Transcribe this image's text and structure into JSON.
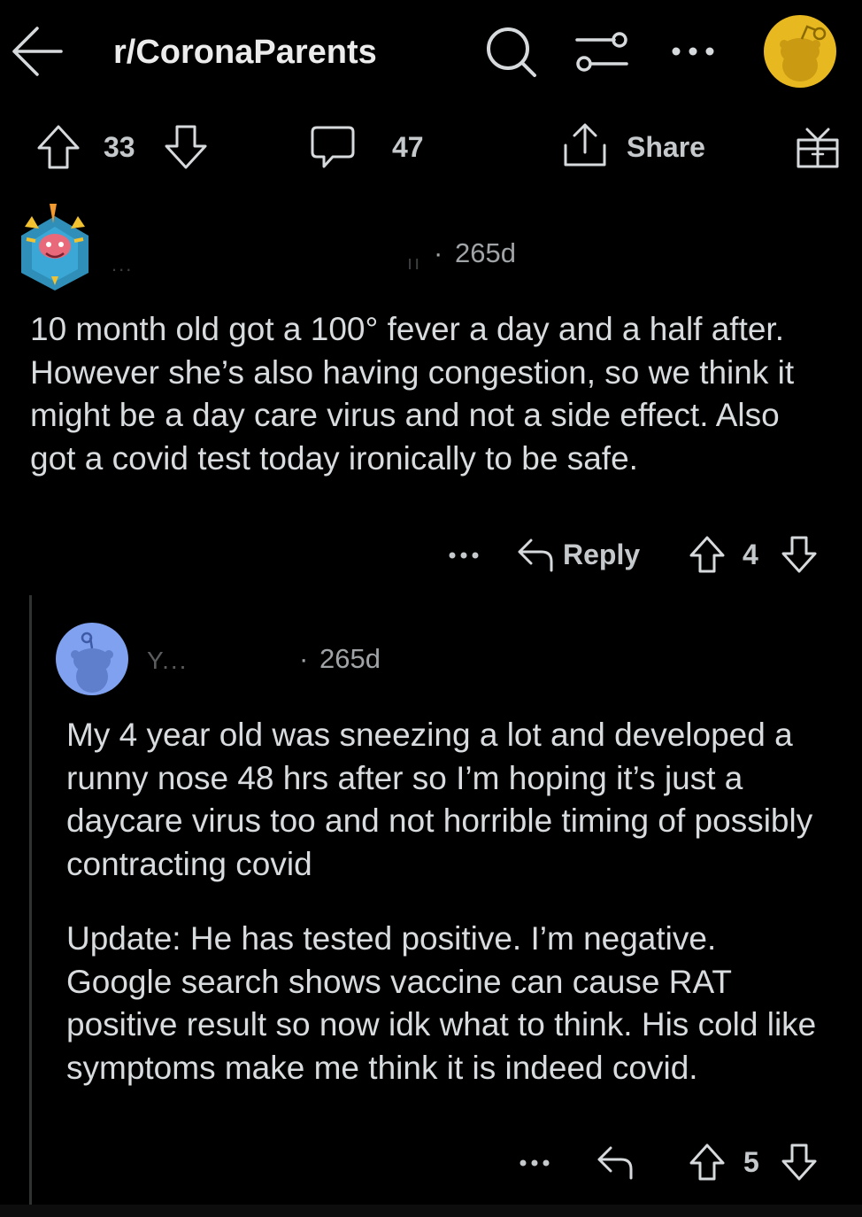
{
  "header": {
    "subreddit": "r/CoronaParents",
    "icons": [
      "back-arrow-icon",
      "search-icon",
      "filter-sliders-icon",
      "more-icon",
      "user-avatar"
    ],
    "accent_avatar": "#e8b820"
  },
  "post_actions": {
    "upvotes": "33",
    "comments": "47",
    "share_label": "Share",
    "icons": [
      "upvote-icon",
      "downvote-icon",
      "comment-icon",
      "share-icon",
      "award-icon"
    ]
  },
  "comments": [
    {
      "username": "...",
      "separator": "·",
      "age": "265d",
      "body": "10 month old got a 100° fever a day and a half after. However she’s also having congestion, so we think it might be a day care virus and not a side effect. Also got a covid test today ironically to be safe.",
      "reply_label": "Reply",
      "score": "4"
    },
    {
      "username": "Y...",
      "separator": "·",
      "age": "265d",
      "body": "My 4 year old was sneezing a lot and developed a runny nose 48 hrs after so I’m hoping it’s just a daycare virus too and not horrible timing of possibly contracting covid",
      "update": "Update: He has tested positive. I’m negative. Google search shows vaccine can cause RAT positive result so now idk what to think. His cold like symptoms make me think it is indeed covid.",
      "score": "5",
      "avatar_color": "#7fa1f0"
    }
  ]
}
